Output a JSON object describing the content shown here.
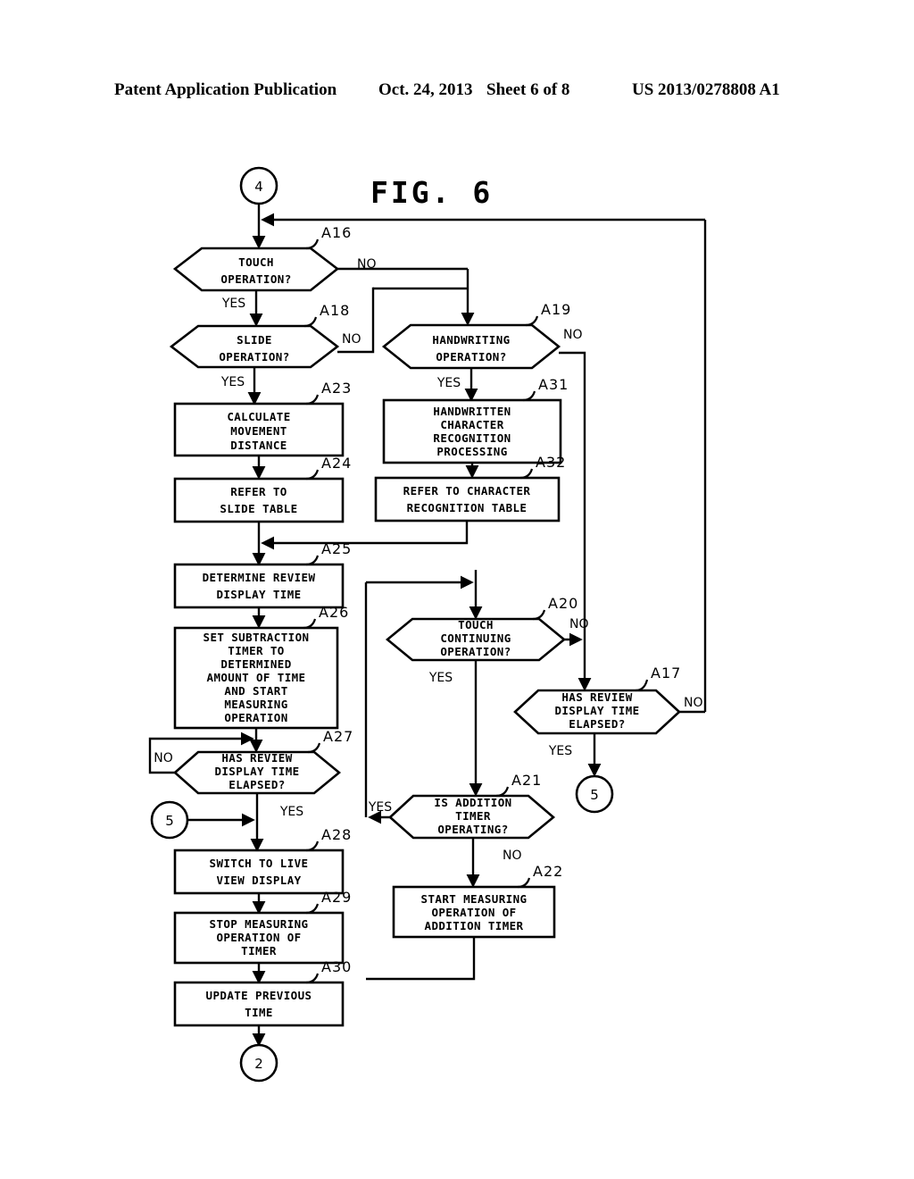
{
  "header": {
    "title": "Patent Application Publication",
    "date": "Oct. 24, 2013",
    "sheet": "Sheet 6 of 8",
    "number": "US 2013/0278808 A1"
  },
  "figure": {
    "title": "FIG. 6",
    "connectors": {
      "entry_top": "4",
      "exit_bottom": "2",
      "connector_left": "5",
      "connector_right": "5"
    },
    "branch_labels": {
      "yes": "YES",
      "no": "NO"
    },
    "nodes": [
      {
        "id": "A16",
        "tag": "A16",
        "shape": "decision",
        "text": [
          "TOUCH",
          "OPERATION?"
        ]
      },
      {
        "id": "A18",
        "tag": "A18",
        "shape": "decision",
        "text": [
          "SLIDE",
          "OPERATION?"
        ]
      },
      {
        "id": "A23",
        "tag": "A23",
        "shape": "process",
        "text": [
          "CALCULATE",
          "MOVEMENT",
          "DISTANCE"
        ]
      },
      {
        "id": "A24",
        "tag": "A24",
        "shape": "process",
        "text": [
          "REFER TO",
          "SLIDE TABLE"
        ]
      },
      {
        "id": "A25",
        "tag": "A25",
        "shape": "process",
        "text": [
          "DETERMINE REVIEW",
          "DISPLAY TIME"
        ]
      },
      {
        "id": "A26",
        "tag": "A26",
        "shape": "process",
        "text": [
          "SET SUBTRACTION",
          "TIMER TO",
          "DETERMINED",
          "AMOUNT OF TIME",
          "AND START",
          "MEASURING",
          "OPERATION"
        ]
      },
      {
        "id": "A27",
        "tag": "A27",
        "shape": "decision",
        "text": [
          "HAS REVIEW",
          "DISPLAY TIME",
          "ELAPSED?"
        ]
      },
      {
        "id": "A28",
        "tag": "A28",
        "shape": "process",
        "text": [
          "SWITCH TO LIVE",
          "VIEW DISPLAY"
        ]
      },
      {
        "id": "A29",
        "tag": "A29",
        "shape": "process",
        "text": [
          "STOP MEASURING",
          "OPERATION OF",
          "TIMER"
        ]
      },
      {
        "id": "A30",
        "tag": "A30",
        "shape": "process",
        "text": [
          "UPDATE PREVIOUS",
          "TIME"
        ]
      },
      {
        "id": "A19",
        "tag": "A19",
        "shape": "decision",
        "text": [
          "HANDWRITING",
          "OPERATION?"
        ]
      },
      {
        "id": "A31",
        "tag": "A31",
        "shape": "process",
        "text": [
          "HANDWRITTEN",
          "CHARACTER",
          "RECOGNITION",
          "PROCESSING"
        ]
      },
      {
        "id": "A32",
        "tag": "A32",
        "shape": "process",
        "text": [
          "REFER TO CHARACTER",
          "RECOGNITION TABLE"
        ]
      },
      {
        "id": "A20",
        "tag": "A20",
        "shape": "decision",
        "text": [
          "TOUCH",
          "CONTINUING",
          "OPERATION?"
        ]
      },
      {
        "id": "A21",
        "tag": "A21",
        "shape": "decision",
        "text": [
          "IS ADDITION",
          "TIMER",
          "OPERATING?"
        ]
      },
      {
        "id": "A22",
        "tag": "A22",
        "shape": "process",
        "text": [
          "START MEASURING",
          "OPERATION OF",
          "ADDITION TIMER"
        ]
      },
      {
        "id": "A17",
        "tag": "A17",
        "shape": "decision",
        "text": [
          "HAS REVIEW",
          "DISPLAY TIME",
          "ELAPSED?"
        ]
      }
    ],
    "edges": [
      {
        "from": "4",
        "to": "A16",
        "label": ""
      },
      {
        "from": "A16",
        "to": "A18",
        "label": "YES"
      },
      {
        "from": "A16",
        "to": "A19",
        "label": "NO"
      },
      {
        "from": "A18",
        "to": "A23",
        "label": "YES"
      },
      {
        "from": "A18",
        "to": "A19",
        "label": "NO"
      },
      {
        "from": "A23",
        "to": "A24",
        "label": ""
      },
      {
        "from": "A24",
        "to": "A25",
        "label": ""
      },
      {
        "from": "A25",
        "to": "A26",
        "label": ""
      },
      {
        "from": "A26",
        "to": "A27",
        "label": ""
      },
      {
        "from": "A27",
        "to": "A27",
        "label": "NO"
      },
      {
        "from": "A27",
        "to": "A28",
        "label": "YES"
      },
      {
        "from": "5",
        "to": "A28",
        "label": ""
      },
      {
        "from": "A28",
        "to": "A29",
        "label": ""
      },
      {
        "from": "A29",
        "to": "A30",
        "label": ""
      },
      {
        "from": "A30",
        "to": "2",
        "label": ""
      },
      {
        "from": "A19",
        "to": "A31",
        "label": "YES"
      },
      {
        "from": "A19",
        "to": "A17",
        "label": "NO"
      },
      {
        "from": "A31",
        "to": "A32",
        "label": ""
      },
      {
        "from": "A32",
        "to": "A25",
        "label": ""
      },
      {
        "from": "A20",
        "to": "A21",
        "label": "YES"
      },
      {
        "from": "A20",
        "to": "A17",
        "label": "NO"
      },
      {
        "from": "A21",
        "to": "A20",
        "label": "YES"
      },
      {
        "from": "A21",
        "to": "A22",
        "label": "NO"
      },
      {
        "from": "A22",
        "to": "A20",
        "label": ""
      },
      {
        "from": "A17",
        "to": "5",
        "label": "YES"
      },
      {
        "from": "A17",
        "to": "A16",
        "label": "NO"
      }
    ]
  }
}
